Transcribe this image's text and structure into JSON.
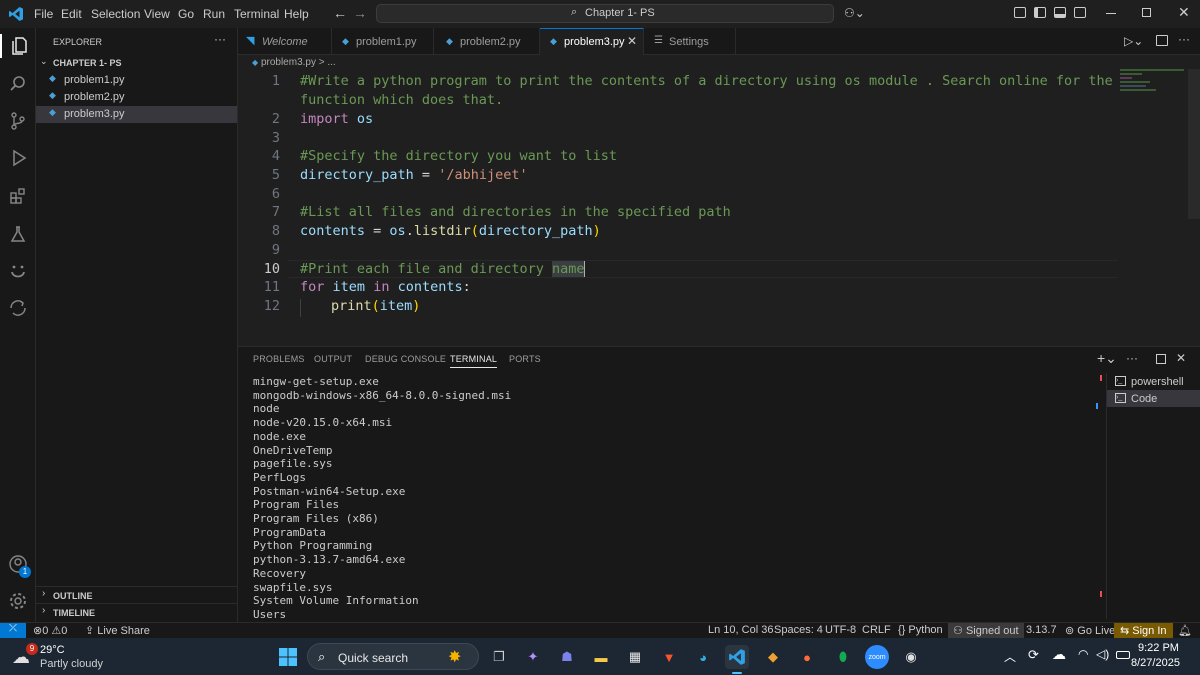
{
  "menu": [
    "File",
    "Edit",
    "Selection",
    "View",
    "Go",
    "Run",
    "Terminal",
    "Help"
  ],
  "command_center": "Chapter 1- PS",
  "sidebar": {
    "header": "EXPLORER",
    "folder": "CHAPTER 1- PS",
    "files": [
      "problem1.py",
      "problem2.py",
      "problem3.py"
    ],
    "outline": "OUTLINE",
    "timeline": "TIMELINE"
  },
  "tabs": [
    {
      "label": "Welcome"
    },
    {
      "label": "problem1.py"
    },
    {
      "label": "problem2.py"
    },
    {
      "label": "problem3.py"
    },
    {
      "label": "Settings"
    }
  ],
  "breadcrumb": "problem3.py > ...",
  "editor": {
    "line_numbers": [
      "1",
      "",
      "2",
      "3",
      "4",
      "5",
      "6",
      "7",
      "8",
      "9",
      "10",
      "11",
      "12"
    ],
    "lines": {
      "l1a": "#Write a python program to print the contents of a directory using os module . Search online for the",
      "l1b": "function which does that.",
      "l2_kw": "import",
      "l2_mod": "os",
      "l4": "#Specify the directory you want to list",
      "l5_var": "directory_path",
      "l5_eq": " = ",
      "l5_str": "'/abhijeet'",
      "l7": "#List all files and directories in the specified path",
      "l8_var": "contents",
      "l8_eq": " = ",
      "l8_mod": "os",
      "l8_dot": ".",
      "l8_fn": "listdir",
      "l8_p1": "(",
      "l8_arg": "directory_path",
      "l8_p2": ")",
      "l10a": "#Print each file and directory ",
      "l10b": "name",
      "l11_for": "for",
      "l11_item": "item",
      "l11_in": "in",
      "l11_contents": "contents",
      "l11_colon": ":",
      "l12_fn": "print",
      "l12_p1": "(",
      "l12_arg": "item",
      "l12_p2": ")"
    }
  },
  "panel": {
    "tabs": [
      "PROBLEMS",
      "OUTPUT",
      "DEBUG CONSOLE",
      "TERMINAL",
      "PORTS"
    ],
    "terminal_lines": [
      "mingw-get-setup.exe",
      "mongodb-windows-x86_64-8.0.0-signed.msi",
      "node",
      "node-v20.15.0-x64.msi",
      "node.exe",
      "OneDriveTemp",
      "pagefile.sys",
      "PerfLogs",
      "Postman-win64-Setup.exe",
      "Program Files",
      "Program Files (x86)",
      "ProgramData",
      "Python Programming",
      "python-3.13.7-amd64.exe",
      "Recovery",
      "swapfile.sys",
      "System Volume Information",
      "Users"
    ],
    "terminals": [
      "powershell",
      "Code"
    ]
  },
  "status": {
    "errors": "0",
    "warnings": "0",
    "live_share": "Live Share",
    "position": "Ln 10, Col 36",
    "spaces": "Spaces: 4",
    "encoding": "UTF-8",
    "eol": "CRLF",
    "language": "Python",
    "account": "Signed out",
    "version": "3.13.7",
    "go_live": "Go Live",
    "sign_in": "Sign In",
    "accounts_badge": "1"
  },
  "taskbar": {
    "temp": "29°C",
    "weather": "Partly cloudy",
    "weather_badge": "9",
    "search": "Quick search",
    "time": "9:22 PM",
    "date": "8/27/2025",
    "zoom_label": "zoom"
  },
  "colors": {
    "accent": "#0078d4",
    "comment": "#6a9955",
    "keyword": "#c586c0",
    "variable": "#9cdcfe",
    "string": "#ce9178",
    "function": "#dcdcaa"
  }
}
